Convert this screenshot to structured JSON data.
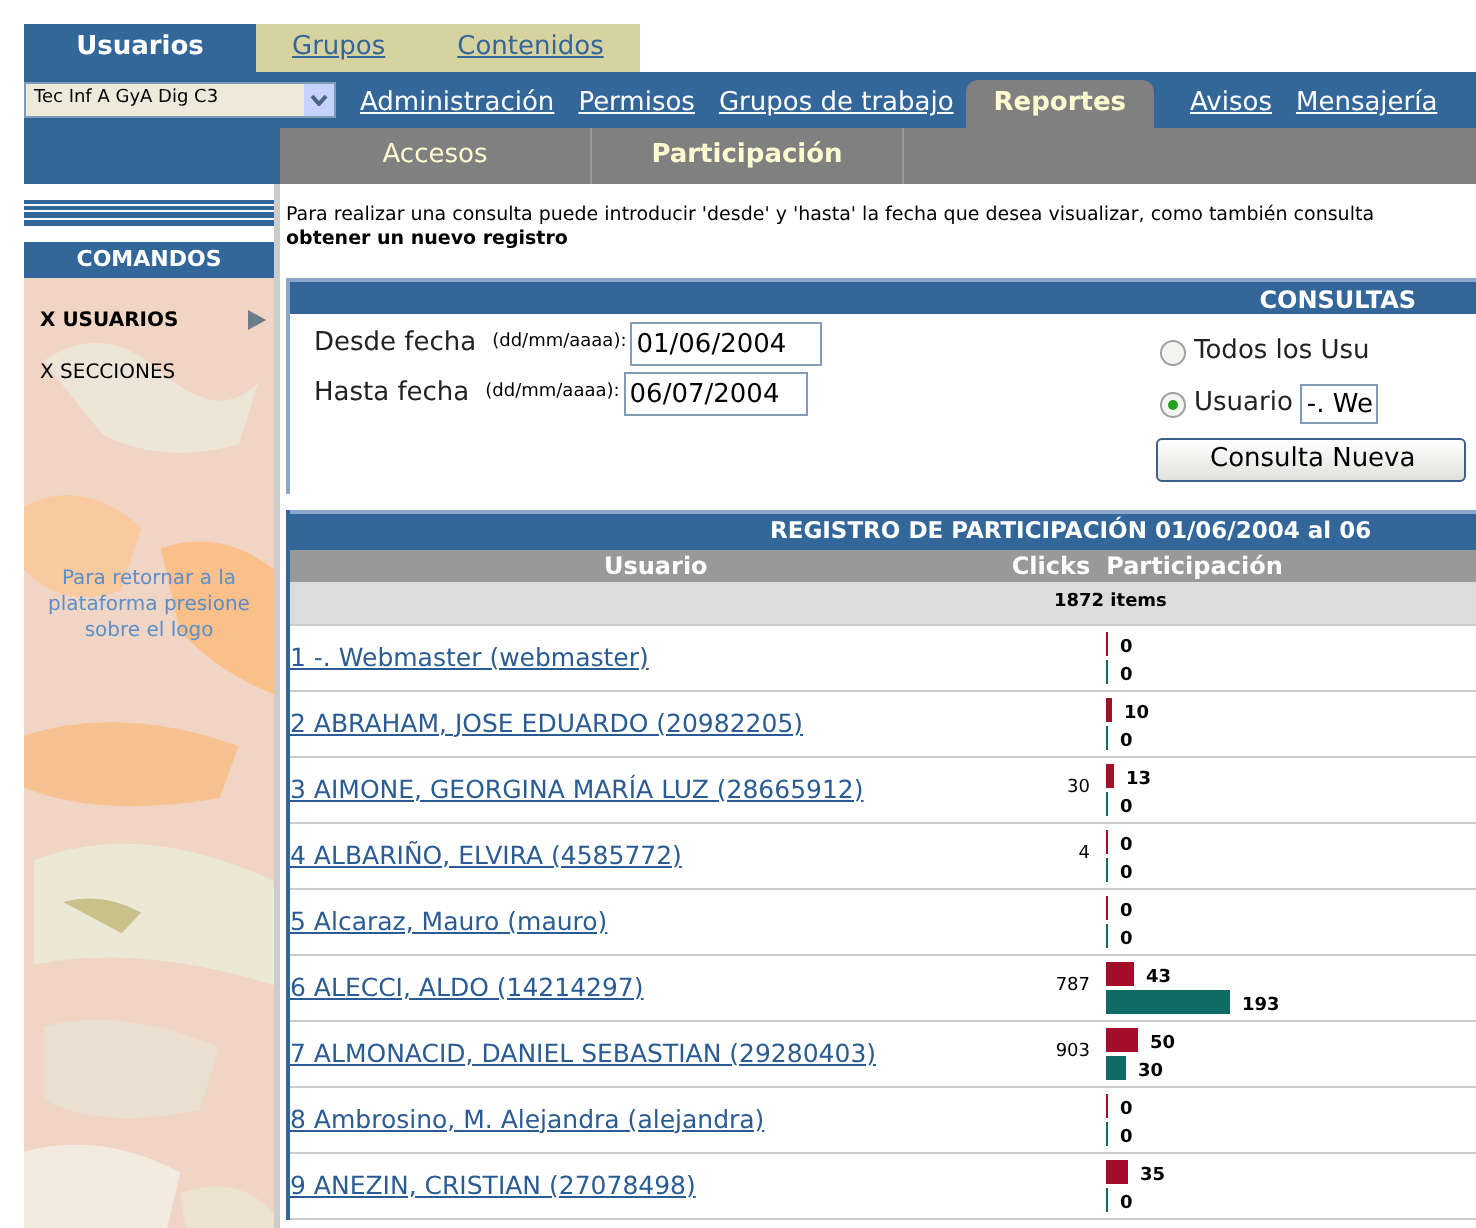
{
  "top_tabs": [
    {
      "label": "Usuarios",
      "selected": true
    },
    {
      "label": "Grupos",
      "selected": false
    },
    {
      "label": "Contenidos",
      "selected": false
    }
  ],
  "course_select": {
    "value": "Tec Inf A GyA Dig C3"
  },
  "nav": [
    {
      "label": "Administración",
      "selected": false
    },
    {
      "label": "Permisos",
      "selected": false
    },
    {
      "label": "Grupos de trabajo",
      "selected": false
    },
    {
      "label": "Reportes",
      "selected": true
    },
    {
      "label": "Avisos",
      "selected": false
    },
    {
      "label": "Mensajería",
      "selected": false
    }
  ],
  "subnav": [
    {
      "label": "Accesos",
      "selected": false
    },
    {
      "label": "Participación",
      "selected": true
    }
  ],
  "sidebar": {
    "title": "COMANDOS",
    "items": [
      {
        "label": "X USUARIOS",
        "selected": true
      },
      {
        "label": "X SECCIONES",
        "selected": false
      }
    ],
    "note": "Para retornar a la plataforma presione sobre el logo"
  },
  "intro": "Para realizar una consulta puede introducir 'desde' y 'hasta' la fecha que desea visualizar, como también consulta",
  "intro_bold": "obtener un nuevo registro",
  "consultas": {
    "title": "CONSULTAS",
    "fields": [
      {
        "label": "Desde fecha",
        "hint": "(dd/mm/aaaa):",
        "value": "01/06/2004"
      },
      {
        "label": "Hasta fecha",
        "hint": "(dd/mm/aaaa):",
        "value": "06/07/2004"
      }
    ],
    "options": [
      {
        "label": "Todos los Usu",
        "selected": false
      },
      {
        "label": "Usuario",
        "selected": true,
        "value": "-. We"
      }
    ],
    "button": "Consulta Nueva"
  },
  "registro": {
    "title": "REGISTRO DE PARTICIPACIÓN 01/06/2004 al 06",
    "columns": [
      "Usuario",
      "Clicks",
      "Participación"
    ],
    "count": "1872 items",
    "rows": [
      {
        "user": "1 -. Webmaster (webmaster)",
        "clicks": "",
        "bars": [
          "0",
          "0"
        ]
      },
      {
        "user": "2 ABRAHAM, JOSE EDUARDO (20982205)",
        "clicks": "",
        "bars": [
          "10",
          "0"
        ]
      },
      {
        "user": "3 AIMONE, GEORGINA MARÍA LUZ (28665912)",
        "clicks": "30",
        "bars": [
          "13",
          "0"
        ]
      },
      {
        "user": "4 ALBARIÑO, ELVIRA (4585772)",
        "clicks": "4",
        "bars": [
          "0",
          "0"
        ]
      },
      {
        "user": "5 Alcaraz, Mauro (mauro)",
        "clicks": "",
        "bars": [
          "0",
          "0"
        ]
      },
      {
        "user": "6 ALECCI, ALDO (14214297)",
        "clicks": "787",
        "bars": [
          "43",
          "193"
        ]
      },
      {
        "user": "7 ALMONACID, DANIEL SEBASTIAN (29280403)",
        "clicks": "903",
        "bars": [
          "50",
          "30"
        ]
      },
      {
        "user": "8 Ambrosino, M. Alejandra (alejandra)",
        "clicks": "",
        "bars": [
          "0",
          "0"
        ]
      },
      {
        "user": "9 ANEZIN, CRISTIAN (27078498)",
        "clicks": "",
        "bars": [
          "35",
          "0"
        ]
      }
    ]
  }
}
